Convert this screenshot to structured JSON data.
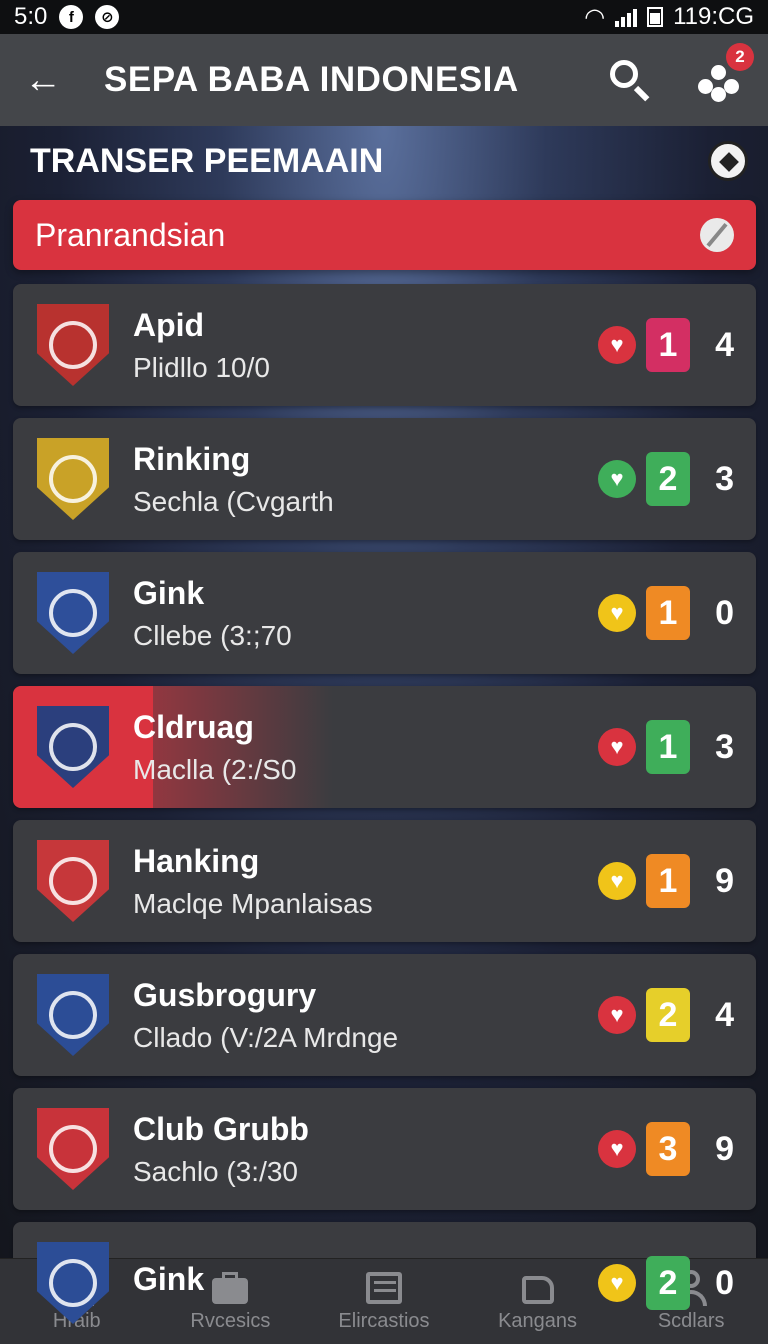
{
  "status_bar": {
    "time": "5:0",
    "clock": "119:CG"
  },
  "app_bar": {
    "back_icon": "arrow-left-icon",
    "title": "SEPA BABA INDONESIA",
    "notification_count": "2"
  },
  "section": {
    "title": "TRANSER PEEMAAIN"
  },
  "filter": {
    "label": "Pranrandsian"
  },
  "rows": [
    {
      "name": "Apid",
      "sub": "Plidllo 10/0",
      "score": "1",
      "count": "4",
      "heart_color": "#d9333f",
      "score_color": "#d32f63",
      "crest_color": "#b8322f",
      "active": false
    },
    {
      "name": "Rinking",
      "sub": "Sechla (Cvgarth",
      "score": "2",
      "count": "3",
      "heart_color": "#3fae5a",
      "score_color": "#3fae5a",
      "crest_color": "#c9a227",
      "active": false
    },
    {
      "name": "Gink",
      "sub": "Cllebe (3:;70",
      "score": "1",
      "count": "0",
      "heart_color": "#f0c419",
      "score_color": "#ef8a24",
      "crest_color": "#2e4f9a",
      "active": false
    },
    {
      "name": "Cldruag",
      "sub": "Maclla (2:/S0",
      "score": "1",
      "count": "3",
      "heart_color": "#d9333f",
      "score_color": "#3fae5a",
      "crest_color": "#2b3f7d",
      "active": true
    },
    {
      "name": "Hanking",
      "sub": "Maclqe Mpanlaisas",
      "score": "1",
      "count": "9",
      "heart_color": "#f0c419",
      "score_color": "#ef8a24",
      "crest_color": "#c6373a",
      "active": false
    },
    {
      "name": "Gusbrogury",
      "sub": "Cllado (V:/2A Mrdnge",
      "score": "2",
      "count": "4",
      "heart_color": "#d9333f",
      "score_color": "#e6cf2a",
      "crest_color": "#2c4d96",
      "active": false
    },
    {
      "name": "Club Grubb",
      "sub": "Sachlo (3:/30",
      "score": "3",
      "count": "9",
      "heart_color": "#d9333f",
      "score_color": "#ef8a24",
      "crest_color": "#c8333a",
      "active": false
    },
    {
      "name": "Gink",
      "sub": "",
      "score": "2",
      "count": "0",
      "heart_color": "#f0c419",
      "score_color": "#3fae5a",
      "crest_color": "#2c4d96",
      "active": false
    }
  ],
  "bottom_nav": [
    {
      "label": "Hraib",
      "icon": "home-icon"
    },
    {
      "label": "Rvcesics",
      "icon": "briefcase-icon"
    },
    {
      "label": "Elircastios",
      "icon": "list-icon"
    },
    {
      "label": "Kangans",
      "icon": "tag-icon"
    },
    {
      "label": "Scdlars",
      "icon": "user-icon"
    }
  ]
}
